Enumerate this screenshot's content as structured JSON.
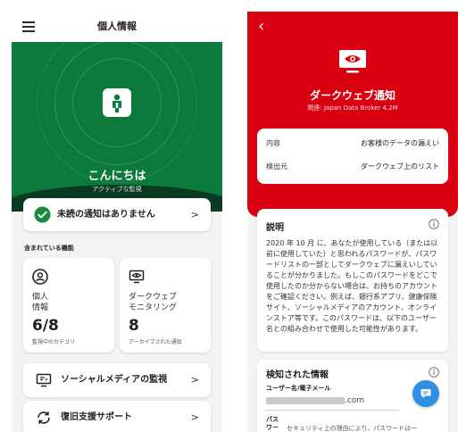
{
  "left_screen": {
    "title": "個人情報",
    "greeting": "こんにちは",
    "greeting_sub": "アクティブな監視",
    "notice": "未読の通知はありません",
    "section_label": "含まれている機能",
    "cards": [
      {
        "label": "個人\n情報",
        "number": "6/8",
        "sub": "監視中のカテゴリ",
        "icon": "person-icon"
      },
      {
        "label": "ダークウェブ\nモニタリング",
        "number": "8",
        "sub": "アーカイブされた通知",
        "icon": "monitor-eye-icon"
      }
    ],
    "rows": [
      {
        "label": "ソーシャルメディアの監視",
        "icon": "social-monitor-icon"
      },
      {
        "label": "復旧支援サポート",
        "icon": "refresh-icon"
      }
    ],
    "colors": {
      "hero_green": "#0b7a3b",
      "dark_green": "#0a3a22",
      "check_green": "#1a8a3c"
    }
  },
  "right_screen": {
    "title": "ダークウェブ通知",
    "subtitle": "関連: Japan Data Broker 4.2M",
    "info": [
      {
        "key": "内容",
        "value": "お客様のデータの漏えい"
      },
      {
        "key": "検出元",
        "value": "ダークウェブ上のリスト"
      }
    ],
    "description_title": "説明",
    "description_body": "2020 年 10 月 に、あなたが使用している（または以前に使用していた）と思われるパスワードが、パスワードリストの一部としてダークウェブに漏えいしていることが分かりました。もしこのパスワードをどこで使用したのか分からない場合は、お持ちのアカウントをご確認ください。例えば、銀行系アプリ、健康保険サイト、ソーシャルメディアのアカウント、オンラインストア等です。このパスワードは、以下のユーザー名との組み合わせで使用した可能性があります。",
    "detected_title": "検知された情報",
    "username_label": "ユーザー名/電子メール",
    "email_suffix": ".com",
    "password_label": "パス\nワー",
    "password_value": "セキュリティ上の理由により、パスワードは一",
    "colors": {
      "accent_red": "#d90012",
      "fab_blue": "#2f8fe0"
    }
  }
}
